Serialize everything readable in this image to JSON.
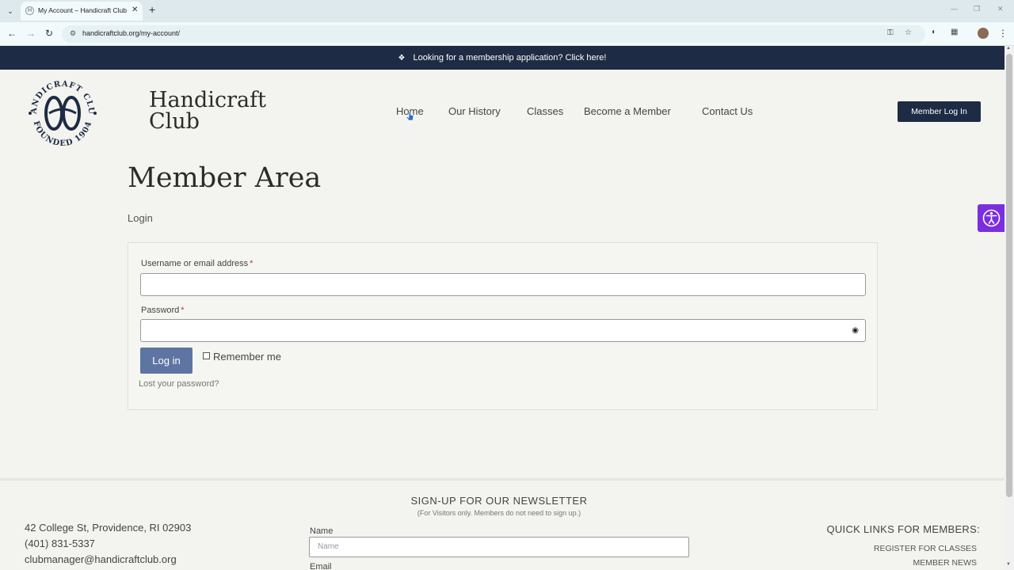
{
  "browser": {
    "tab_title": "My Account – Handicraft Club",
    "tab_favicon": "H",
    "url": "handicraftclub.org/my-account/"
  },
  "announcement": {
    "text": "Looking for a membership application? Click here!"
  },
  "brand": {
    "line1": "Handicraft",
    "line2": "Club"
  },
  "seal": {
    "top_text": "HANDICRAFT CLUB",
    "bottom_text": "FOUNDED 1904"
  },
  "nav": {
    "items": [
      "Home",
      "Our History",
      "Classes",
      "Become a Member",
      "Contact Us"
    ],
    "member_login": "Member Log In"
  },
  "main": {
    "title": "Member Area",
    "subtitle": "Login",
    "form": {
      "username_label": "Username or email address",
      "password_label": "Password",
      "required_mark": "*",
      "username_value": "",
      "password_value": "",
      "login_button": "Log in",
      "remember_label": "Remember me",
      "remember_checked": false,
      "lost_password": "Lost your password?"
    }
  },
  "footer": {
    "address": "42 College St, Providence, RI 02903",
    "phone": "(401) 831-5337",
    "email": "clubmanager@handicraftclub.org",
    "newsletter_title": "SIGN-UP FOR OUR NEWSLETTER",
    "newsletter_subtitle": "(For Visitors only.  Members do not need to sign up.)",
    "name_label": "Name",
    "name_placeholder": "Name",
    "email_label": "Email",
    "quick_links_title": "QUICK LINKS FOR MEMBERS:",
    "quick_links": [
      "REGISTER FOR CLASSES",
      "MEMBER NEWS"
    ]
  },
  "colors": {
    "navy": "#1d2b44",
    "button_blue": "#5e74a3",
    "accessibility_purple": "#7a2ee0",
    "page_bg": "#f3f4ef"
  }
}
